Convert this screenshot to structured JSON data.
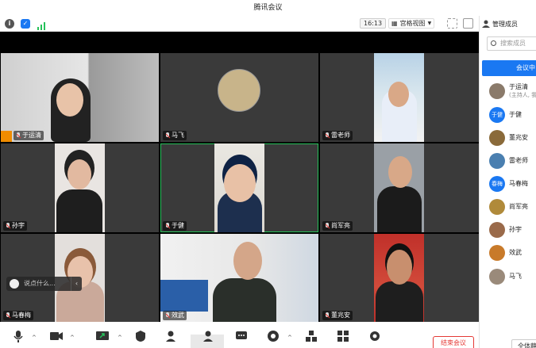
{
  "window": {
    "title": "腾讯会议"
  },
  "top_toolbar": {
    "time": "16:13",
    "view_label": "宫格视图",
    "icons": [
      "info-icon",
      "shield-icon",
      "signal-icon"
    ]
  },
  "tiles": [
    {
      "name": "于运清",
      "host": true
    },
    {
      "name": "马飞"
    },
    {
      "name": "雷老师"
    },
    {
      "name": "孙宇"
    },
    {
      "name": "于健",
      "active": true
    },
    {
      "name": "尚军亮"
    },
    {
      "name": "马春梅"
    },
    {
      "name": "效武"
    },
    {
      "name": "董兆安"
    }
  ],
  "chat": {
    "placeholder": "说点什么..."
  },
  "bottom_bar": {
    "end_label": "结束会议",
    "buttons": [
      "mic",
      "camera",
      "share-screen",
      "security",
      "invite",
      "members",
      "chat",
      "record",
      "apps",
      "settings"
    ]
  },
  "sidebar": {
    "title": "管理成员",
    "search_placeholder": "搜索成员",
    "in_meeting_label": "会议中",
    "members": [
      {
        "name": "于运清",
        "sub": "(主持人, 我)",
        "avatar": "photo",
        "color": "#8a7a6a"
      },
      {
        "name": "于健",
        "avatar_text": "于健",
        "color": "#1a78f2"
      },
      {
        "name": "董兆安",
        "avatar": "photo",
        "color": "#8a6a3a"
      },
      {
        "name": "雷老师",
        "avatar": "photo",
        "color": "#4a7fb0"
      },
      {
        "name": "马春梅",
        "avatar_text": "春梅",
        "color": "#1a78f2"
      },
      {
        "name": "尚军亮",
        "avatar": "photo",
        "color": "#b08a3a"
      },
      {
        "name": "孙宇",
        "avatar": "photo",
        "color": "#9a6a4a"
      },
      {
        "name": "效武",
        "avatar": "photo",
        "color": "#c87a2a"
      },
      {
        "name": "马飞",
        "avatar": "photo",
        "color": "#9a8a7a"
      }
    ],
    "bottom_label": "全体静"
  }
}
